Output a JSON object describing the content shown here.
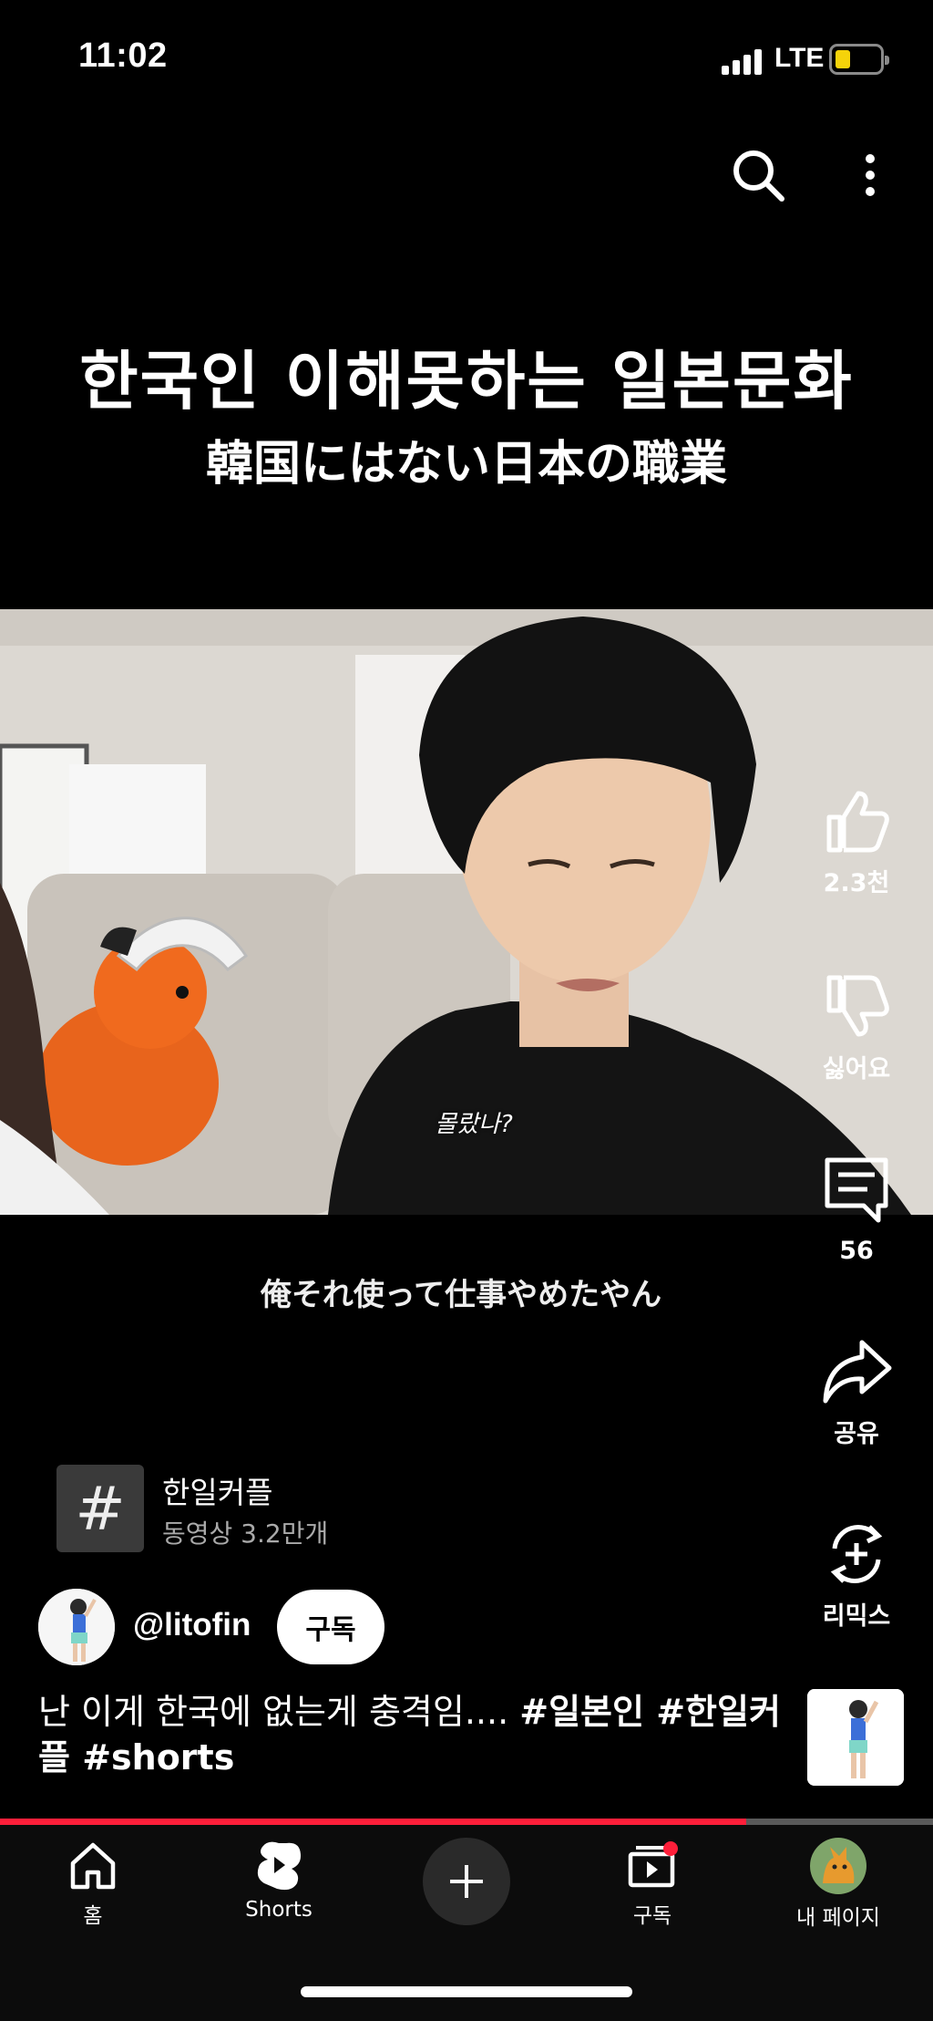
{
  "status_bar": {
    "time": "11:02",
    "network": "LTE",
    "battery_color": "#f5d30a"
  },
  "video": {
    "title_korean": "한국인 이해못하는 일본문화",
    "title_japanese": "韓国にはない日本の職業",
    "caption_in_frame": "몰랐나?",
    "subtitle": "俺それ使って仕事やめたやん",
    "progress": 0.8
  },
  "actions": {
    "like_count": "2.3천",
    "dislike_label": "싫어요",
    "comment_count": "56",
    "share_label": "공유",
    "remix_label": "리믹스"
  },
  "hashtag_chip": {
    "symbol": "#",
    "name": "한일커플",
    "video_count": "동영상 3.2만개"
  },
  "channel": {
    "handle": "@litofin",
    "subscribe_label": "구독"
  },
  "description": {
    "text": "난 이게 한국에 없는게 충격임....",
    "hashtags": "#일본인 #한일커플 #shorts"
  },
  "nav": {
    "home": "홈",
    "shorts": "Shorts",
    "subscriptions": "구독",
    "my_page": "내 페이지"
  },
  "colors": {
    "accent": "#ff1f3a",
    "background": "#000000"
  }
}
